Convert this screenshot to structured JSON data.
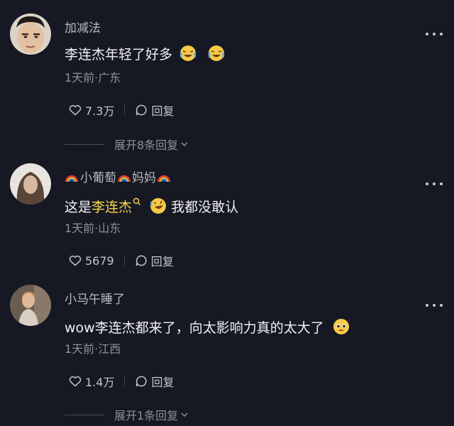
{
  "comments": [
    {
      "username": "加减法",
      "text": "李连杰年轻了好多",
      "emojis": [
        "laugh-cry-emoji",
        "laugh-cry-emoji"
      ],
      "meta": "1天前·广东",
      "likes": "7.3万",
      "reply_label": "回复",
      "expand_label": "展开8条回复"
    },
    {
      "username_prefix_emoji": "rainbow-emoji",
      "username_part1": "小葡萄",
      "username_mid_emoji": "rainbow-emoji",
      "username_part2": "妈妈",
      "username_suffix_emoji": "rainbow-emoji",
      "text_before": "这是",
      "text_highlight": "李连杰",
      "text_after": "我都没敢认",
      "meta": "1天前·山东",
      "likes": "5679",
      "reply_label": "回复"
    },
    {
      "username": "小马午睡了",
      "text": "wow李连杰都来了，向太影响力真的太大了",
      "meta": "1天前·江西",
      "likes": "1.4万",
      "reply_label": "回复",
      "expand_label": "展开1条回复"
    }
  ],
  "colors": {
    "background": "#161823",
    "highlight": "#f5d64b",
    "meta_text": "#8e8f99"
  }
}
